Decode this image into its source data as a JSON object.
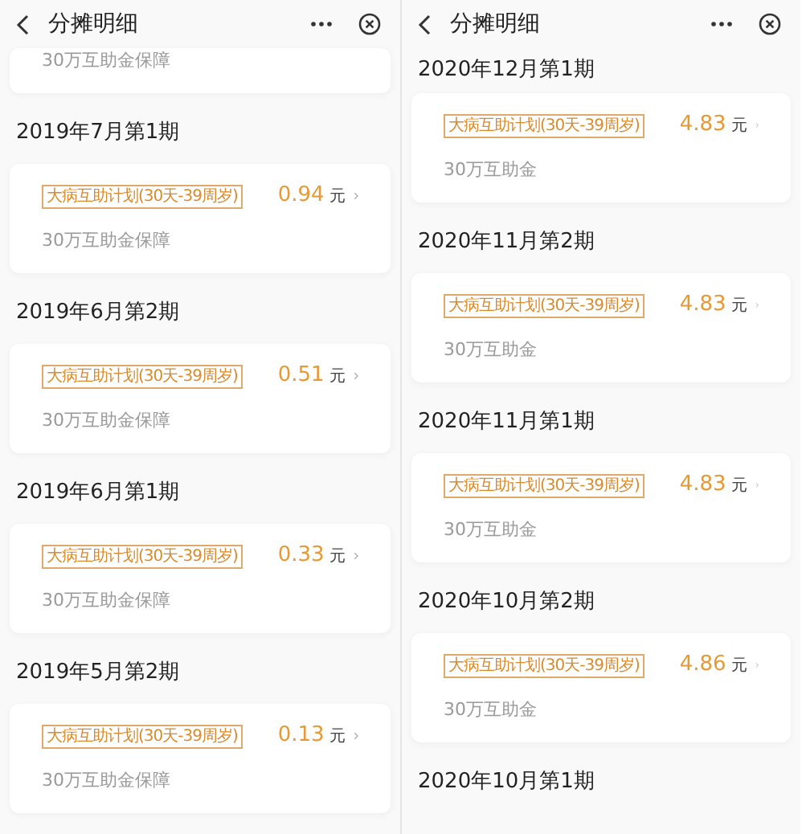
{
  "panels": [
    {
      "title": "分摊明细",
      "items": [
        {
          "note": "30万互助金保障"
        },
        {
          "heading": "2019年7月第1期",
          "tag": "大病互助计划(30天-39周岁)",
          "amount": "0.94",
          "unit": "元",
          "note": "30万互助金保障"
        },
        {
          "heading": "2019年6月第2期",
          "tag": "大病互助计划(30天-39周岁)",
          "amount": "0.51",
          "unit": "元",
          "note": "30万互助金保障"
        },
        {
          "heading": "2019年6月第1期",
          "tag": "大病互助计划(30天-39周岁)",
          "amount": "0.33",
          "unit": "元",
          "note": "30万互助金保障"
        },
        {
          "heading": "2019年5月第2期",
          "tag": "大病互助计划(30天-39周岁)",
          "amount": "0.13",
          "unit": "元",
          "note": "30万互助金保障"
        }
      ]
    },
    {
      "title": "分摊明细",
      "items": [
        {
          "heading": "2020年12月第1期",
          "tag": "大病互助计划(30天-39周岁)",
          "amount": "4.83",
          "unit": "元",
          "note": "30万互助金"
        },
        {
          "heading": "2020年11月第2期",
          "tag": "大病互助计划(30天-39周岁)",
          "amount": "4.83",
          "unit": "元",
          "note": "30万互助金"
        },
        {
          "heading": "2020年11月第1期",
          "tag": "大病互助计划(30天-39周岁)",
          "amount": "4.83",
          "unit": "元",
          "note": "30万互助金"
        },
        {
          "heading": "2020年10月第2期",
          "tag": "大病互助计划(30天-39周岁)",
          "amount": "4.86",
          "unit": "元",
          "note": "30万互助金"
        },
        {
          "heading": "2020年10月第1期"
        }
      ]
    }
  ]
}
